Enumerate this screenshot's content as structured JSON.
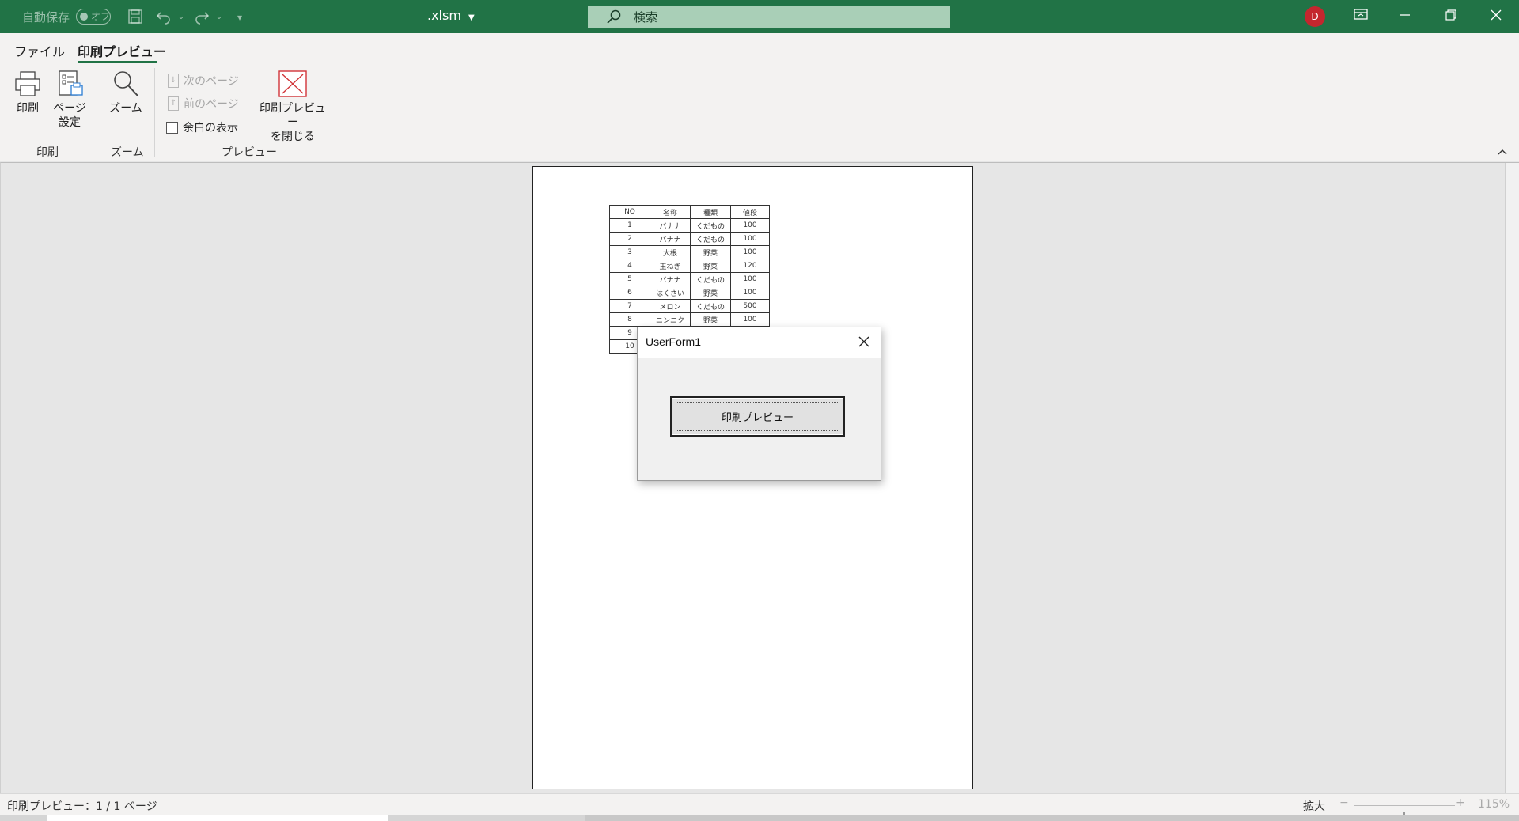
{
  "titlebar": {
    "autosave_label": "自動保存",
    "autosave_state": "オフ",
    "filename": ".xlsm",
    "search_placeholder": "検索",
    "user_initial": "D",
    "brand_color": "#217346"
  },
  "ribbon": {
    "tabs": [
      "ファイル",
      "印刷プレビュー"
    ],
    "active_tab": "印刷プレビュー",
    "groups": {
      "print": {
        "label": "印刷",
        "print_button": "印刷",
        "page_setup_line1": "ページ",
        "page_setup_line2": "設定"
      },
      "zoom": {
        "label": "ズーム",
        "zoom_button": "ズーム"
      },
      "preview": {
        "label": "プレビュー",
        "next_page": "次のページ",
        "prev_page": "前のページ",
        "show_margins": "余白の表示",
        "show_margins_checked": false,
        "close_line1": "印刷プレビュー",
        "close_line2": "を閉じる"
      }
    }
  },
  "sheet": {
    "headers": [
      "NO",
      "名称",
      "種類",
      "値段"
    ],
    "rows": [
      [
        "1",
        "バナナ",
        "くだもの",
        "100"
      ],
      [
        "2",
        "バナナ",
        "くだもの",
        "100"
      ],
      [
        "3",
        "大根",
        "野菜",
        "100"
      ],
      [
        "4",
        "玉ねぎ",
        "野菜",
        "120"
      ],
      [
        "5",
        "バナナ",
        "くだもの",
        "100"
      ],
      [
        "6",
        "はくさい",
        "野菜",
        "100"
      ],
      [
        "7",
        "メロン",
        "くだもの",
        "500"
      ],
      [
        "8",
        "ニンニク",
        "野菜",
        "100"
      ],
      [
        "9",
        "",
        "",
        ""
      ],
      [
        "10",
        "",
        "",
        ""
      ]
    ]
  },
  "userform": {
    "title": "UserForm1",
    "button_label": "印刷プレビュー"
  },
  "statusbar": {
    "status": "印刷プレビュー：1 / 1 ページ",
    "zoom_label": "拡大",
    "zoom_minus": "−",
    "zoom_plus": "+",
    "zoom_percent": "115%",
    "zoom_level": 0.5
  }
}
